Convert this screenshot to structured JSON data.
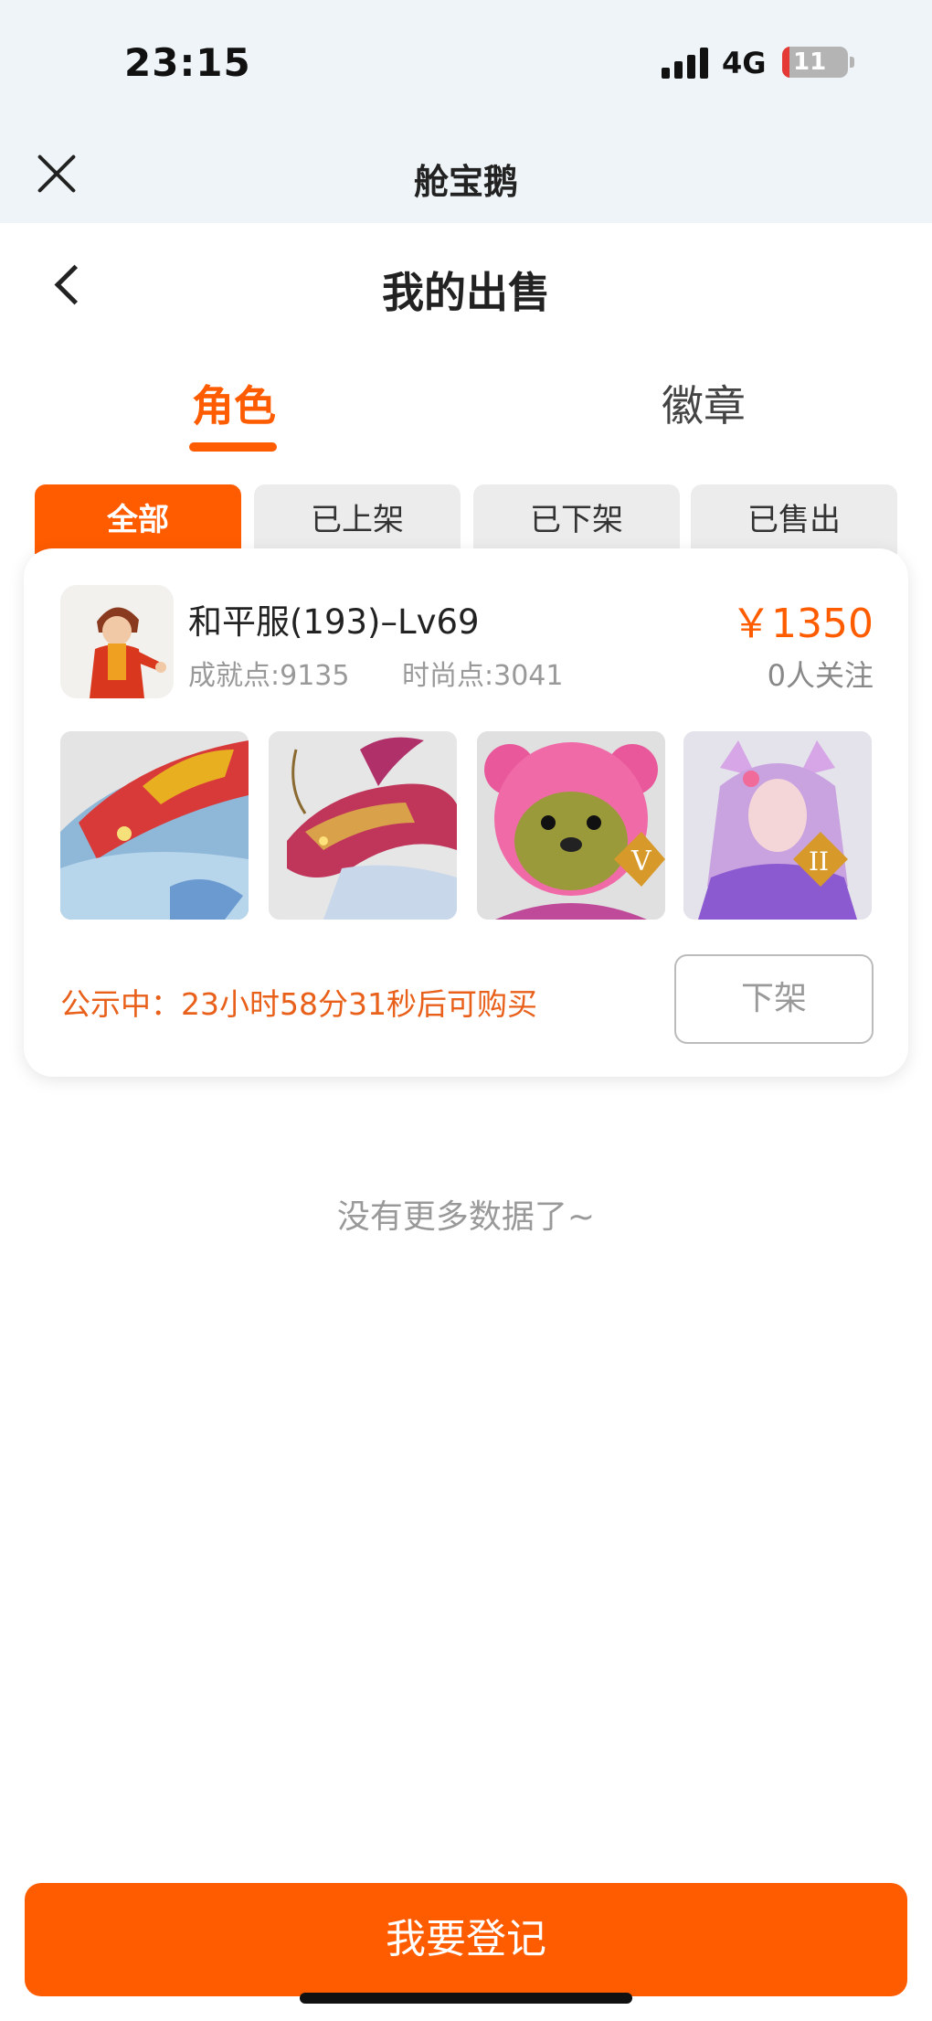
{
  "status_bar": {
    "time": "23:15",
    "network": "4G",
    "battery": "11"
  },
  "app_header": {
    "title": "舱宝鹅"
  },
  "page": {
    "title": "我的出售"
  },
  "tabs": [
    {
      "label": "角色",
      "active": true
    },
    {
      "label": "徽章",
      "active": false
    }
  ],
  "filters": [
    {
      "label": "全部",
      "active": true
    },
    {
      "label": "已上架",
      "active": false
    },
    {
      "label": "已下架",
      "active": false
    },
    {
      "label": "已售出",
      "active": false
    }
  ],
  "listing": {
    "title": "和平服(193)–Lv69",
    "price": "￥1350",
    "achievement": "成就点:9135",
    "fashion": "时尚点:3041",
    "followers": "0人关注",
    "thumbnails": [
      "shark-skin",
      "dragon-skin",
      "pink-bear-skin",
      "fox-girl-skin"
    ],
    "badges": [
      "V",
      "II"
    ],
    "notice": "公示中：23小时58分31秒后可购买",
    "delist_label": "下架"
  },
  "footer_text": "没有更多数据了~",
  "register_button": "我要登记",
  "colors": {
    "accent": "#ff5c00",
    "notice": "#e8601a",
    "background_top": "#eef4f7"
  }
}
